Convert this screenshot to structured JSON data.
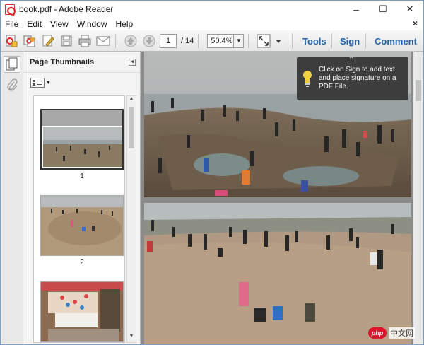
{
  "window": {
    "title": "book.pdf - Adobe Reader",
    "controls": {
      "minimize": "–",
      "maximize": "☐",
      "close": "✕"
    }
  },
  "menu": {
    "items": [
      "File",
      "Edit",
      "View",
      "Window",
      "Help"
    ],
    "close_doc": "×"
  },
  "toolbar": {
    "page_current": "1",
    "page_total": "/ 14",
    "zoom": "50.4%",
    "tools_label": "Tools",
    "sign_label": "Sign",
    "comment_label": "Comment"
  },
  "thumbnails": {
    "header": "Page Thumbnails",
    "pages": [
      {
        "label": "1",
        "selected": true
      },
      {
        "label": "2",
        "selected": false
      },
      {
        "label": "",
        "selected": false
      }
    ]
  },
  "tooltip": {
    "caret": "⌃",
    "text": "Click on Sign to add text and place signature on a PDF File."
  },
  "watermark": {
    "badge": "php",
    "text": "中文网"
  },
  "colors": {
    "link_blue": "#2464a8",
    "tooltip_bg": "#3d3d3d",
    "doc_bg": "#8a8a8a"
  }
}
